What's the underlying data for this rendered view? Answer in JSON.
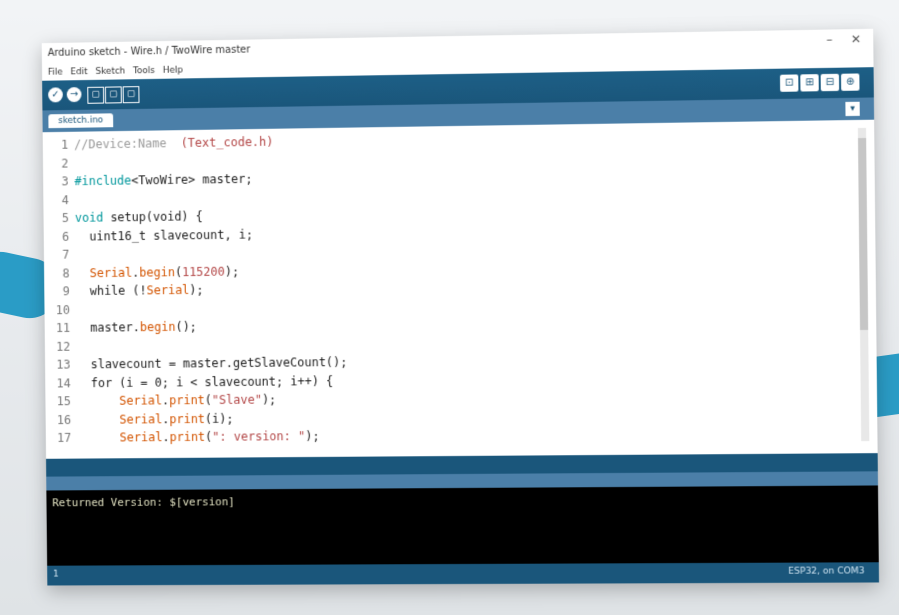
{
  "window": {
    "title": "Arduino sketch - Wire.h / TwoWire master",
    "min_icon": "minimize-icon",
    "close_icon": "close-icon",
    "min_glyph": "–",
    "close_glyph": "✕"
  },
  "menu": [
    "File",
    "Edit",
    "Sketch",
    "Tools",
    "Help"
  ],
  "toolbar": {
    "verify_glyph": "✓",
    "upload_glyph": "→",
    "new_glyph": "▢",
    "open_glyph": "▢",
    "save_glyph": "▢",
    "right_glyphs": [
      "⊡",
      "⊞",
      "⊟",
      "⊕"
    ]
  },
  "tab": {
    "label": "sketch.ino",
    "menu_glyph": "▾"
  },
  "code": [
    {
      "n": "1",
      "parts": [
        {
          "t": "cmt",
          "v": "//Device:Name  "
        },
        {
          "t": "str",
          "v": "(Text_code.h)"
        }
      ]
    },
    {
      "n": "2",
      "parts": []
    },
    {
      "n": "3",
      "parts": [
        {
          "t": "kw",
          "v": "#include"
        },
        {
          "t": "plain",
          "v": "<TwoWire> master;"
        }
      ]
    },
    {
      "n": "4",
      "parts": []
    },
    {
      "n": "5",
      "parts": [
        {
          "t": "kw",
          "v": "void "
        },
        {
          "t": "plain",
          "v": "setup(void) {"
        }
      ]
    },
    {
      "n": "6",
      "parts": [
        {
          "t": "plain",
          "v": "  uint16_t slavecount, i;"
        }
      ]
    },
    {
      "n": "7",
      "parts": []
    },
    {
      "n": "8",
      "parts": [
        {
          "t": "plain",
          "v": "  "
        },
        {
          "t": "fn",
          "v": "Serial"
        },
        {
          "t": "plain",
          "v": "."
        },
        {
          "t": "fn",
          "v": "begin"
        },
        {
          "t": "plain",
          "v": "("
        },
        {
          "t": "str",
          "v": "115200"
        },
        {
          "t": "plain",
          "v": ");"
        }
      ]
    },
    {
      "n": "9",
      "parts": [
        {
          "t": "plain",
          "v": "  while (!"
        },
        {
          "t": "fn",
          "v": "Serial"
        },
        {
          "t": "plain",
          "v": ");"
        }
      ]
    },
    {
      "n": "10",
      "parts": []
    },
    {
      "n": "11",
      "parts": [
        {
          "t": "plain",
          "v": "  master."
        },
        {
          "t": "fn",
          "v": "begin"
        },
        {
          "t": "plain",
          "v": "();"
        }
      ]
    },
    {
      "n": "12",
      "parts": []
    },
    {
      "n": "13",
      "parts": [
        {
          "t": "plain",
          "v": "  slavecount = master.getSlaveCount();"
        }
      ]
    },
    {
      "n": "14",
      "parts": [
        {
          "t": "plain",
          "v": "  for (i = 0; i < slavecount; i++) {"
        }
      ]
    },
    {
      "n": "15",
      "parts": [
        {
          "t": "plain",
          "v": "      "
        },
        {
          "t": "fn",
          "v": "Serial"
        },
        {
          "t": "plain",
          "v": "."
        },
        {
          "t": "fn",
          "v": "print"
        },
        {
          "t": "plain",
          "v": "("
        },
        {
          "t": "str",
          "v": "\"Slave\""
        },
        {
          "t": "plain",
          "v": ");"
        }
      ]
    },
    {
      "n": "16",
      "parts": [
        {
          "t": "plain",
          "v": "      "
        },
        {
          "t": "fn",
          "v": "Serial"
        },
        {
          "t": "plain",
          "v": "."
        },
        {
          "t": "fn",
          "v": "print"
        },
        {
          "t": "plain",
          "v": "(i);"
        }
      ]
    },
    {
      "n": "17",
      "parts": [
        {
          "t": "plain",
          "v": "      "
        },
        {
          "t": "fn",
          "v": "Serial"
        },
        {
          "t": "plain",
          "v": "."
        },
        {
          "t": "fn",
          "v": "print"
        },
        {
          "t": "plain",
          "v": "("
        },
        {
          "t": "str",
          "v": "\": version: \""
        },
        {
          "t": "plain",
          "v": ");"
        }
      ]
    }
  ],
  "console": {
    "output": "Returned Version: $[version]"
  },
  "status": {
    "line": "1",
    "board": "ESP32, on COM3"
  },
  "colors": {
    "toolbar": "#1a567b",
    "tabbar": "#4b7fa8",
    "console_bg": "#000000",
    "keyword": "#00979c",
    "function": "#d35400",
    "string": "#b34747"
  }
}
